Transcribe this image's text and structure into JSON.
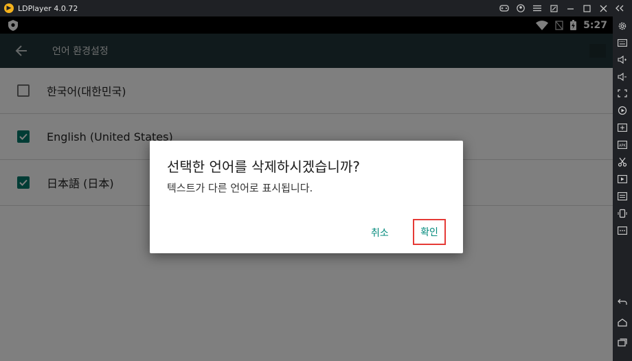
{
  "window": {
    "title": "LDPlayer 4.0.72"
  },
  "status_bar": {
    "time": "5:27"
  },
  "app_bar": {
    "title": "언어 환경설정"
  },
  "languages": [
    {
      "label": "한국어(대한민국)",
      "checked": false
    },
    {
      "label": "English (United States)",
      "checked": true
    },
    {
      "label": "日本語 (日本)",
      "checked": true
    }
  ],
  "dialog": {
    "title": "선택한 언어를 삭제하시겠습니까?",
    "message": "텍스트가 다른 언어로 표시됩니다.",
    "cancel_label": "취소",
    "ok_label": "확인"
  },
  "colors": {
    "accent": "#00897b",
    "app_bar": "#213438",
    "highlight_border": "#e53935"
  }
}
